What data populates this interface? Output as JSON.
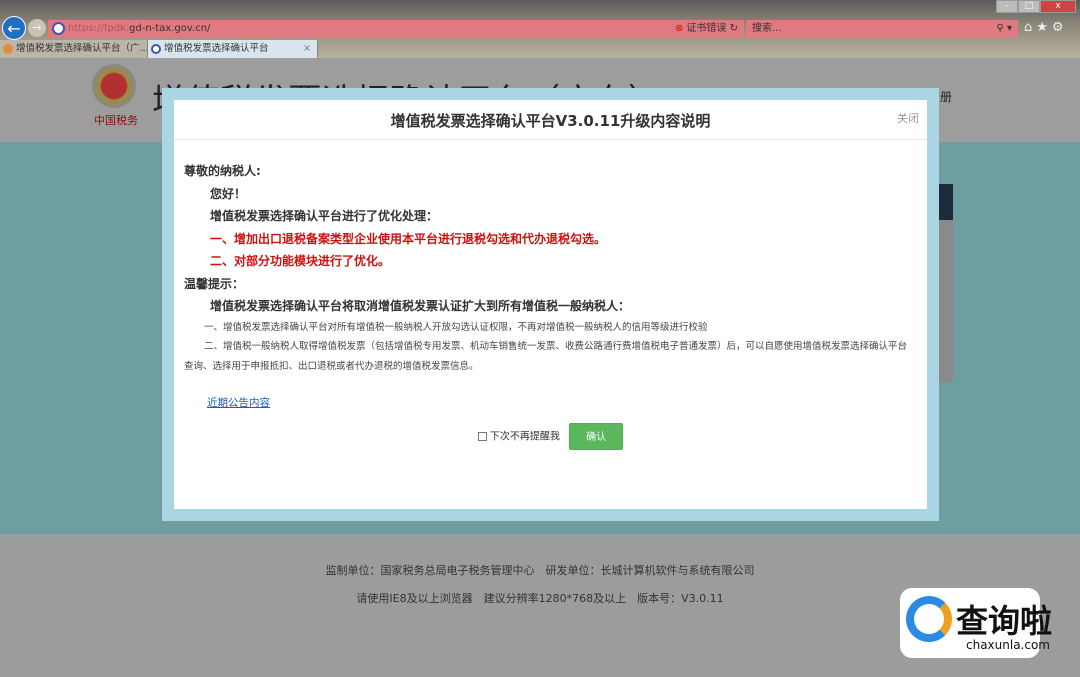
{
  "browser": {
    "url_prefix": "https://fpdk.",
    "url_domain": "gd-n-tax.gov.cn/",
    "cert_error": "证书错误",
    "search_placeholder": "搜索...",
    "tabs": [
      {
        "label": "增值税发票选择确认平台（广..."
      },
      {
        "label": "增值税发票选择确认平台",
        "close": "×"
      }
    ]
  },
  "site": {
    "title": "增值税发票选择确认平台（广东）",
    "emblem_text": "中国税务",
    "register": "册"
  },
  "modal": {
    "title": "增值税发票选择确认平台V3.0.11升级内容说明",
    "close": "关闭",
    "greeting": "尊敬的纳税人:",
    "hello": "您好！",
    "intro": "增值税发票选择确认平台进行了优化处理：",
    "items": [
      "一、增加出口退税备案类型企业使用本平台进行退税勾选和代办退税勾选。",
      "二、对部分功能模块进行了优化。"
    ],
    "tips_title": "温馨提示：",
    "tips_headline": "增值税发票选择确认平台将取消增值税发票认证扩大到所有增值税一般纳税人：",
    "tips": [
      "一、增值税发票选择确认平台对所有增值税一般纳税人开放勾选认证权限，不再对增值税一般纳税人的信用等级进行校验",
      "二、增值税一般纳税人取得增值税发票（包括增值税专用发票、机动车销售统一发票、收费公路通行费增值税电子普通发票）后，可以自愿使用增值税发票选择确认平台查询、选择用于申报抵扣、出口退税或者代办退税的增值税发票信息。"
    ],
    "link": "近期公告内容",
    "checkbox_label": "下次不再提醒我",
    "confirm": "确认"
  },
  "footer": {
    "line1": "监制单位：国家税务总局电子税务管理中心　研发单位：长城计算机软件与系统有限公司",
    "line2": "请使用IE8及以上浏览器　建议分辨率1280*768及以上　版本号：V3.0.11"
  },
  "watermark": {
    "brand": "查询啦",
    "url": "chaxunla.com"
  }
}
